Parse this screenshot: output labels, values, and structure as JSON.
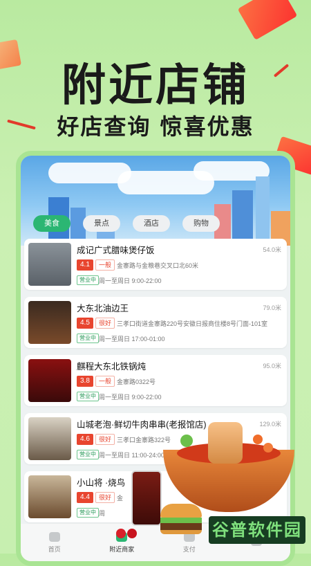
{
  "hero": {
    "title": "附近店铺",
    "subtitle": "好店查询 惊喜优惠"
  },
  "tabs": [
    {
      "label": "美食",
      "active": true
    },
    {
      "label": "景点",
      "active": false
    },
    {
      "label": "酒店",
      "active": false
    },
    {
      "label": "购物",
      "active": false
    }
  ],
  "shops": [
    {
      "name": "成记广式腊味煲仔饭",
      "distance": "54.0米",
      "score": "4.1",
      "level": "一般",
      "address": "金寨路与金粮巷交叉口北60米",
      "status": "营业中",
      "hours": "周一至周日 9:00-22:00"
    },
    {
      "name": "大东北油边王",
      "distance": "79.0米",
      "score": "4.5",
      "level": "很好",
      "address": "三孝口街道金寨路220号安徽日报商住楼8号门面-101室",
      "status": "营业中",
      "hours": "周一至周日 17:00-01:00"
    },
    {
      "name": "麒程大东北铁锅炖",
      "distance": "95.0米",
      "score": "3.8",
      "level": "一般",
      "address": "金寨路0322号",
      "status": "营业中",
      "hours": "周一至周日 9:00-22:00"
    },
    {
      "name": "山城老泡·鲜切牛肉串串(老报馆店)",
      "distance": "129.0米",
      "score": "4.6",
      "level": "很好",
      "address": "三孝口金寨路322号",
      "status": "营业中",
      "hours": "周一至周日 11:00-24:00"
    },
    {
      "name": "小山将 ·烧鸟",
      "distance": "",
      "score": "4.4",
      "level": "很好",
      "address": "金",
      "status": "营业中",
      "hours": "周"
    }
  ],
  "nav": [
    {
      "label": "首页",
      "active": false
    },
    {
      "label": "附近商家",
      "active": true
    },
    {
      "label": "支付",
      "active": false
    },
    {
      "label": "",
      "active": false
    }
  ],
  "watermark": "谷普软件园",
  "colors": {
    "accent": "#2bb673",
    "score": "#e8452f",
    "bg": "#c5efad"
  }
}
